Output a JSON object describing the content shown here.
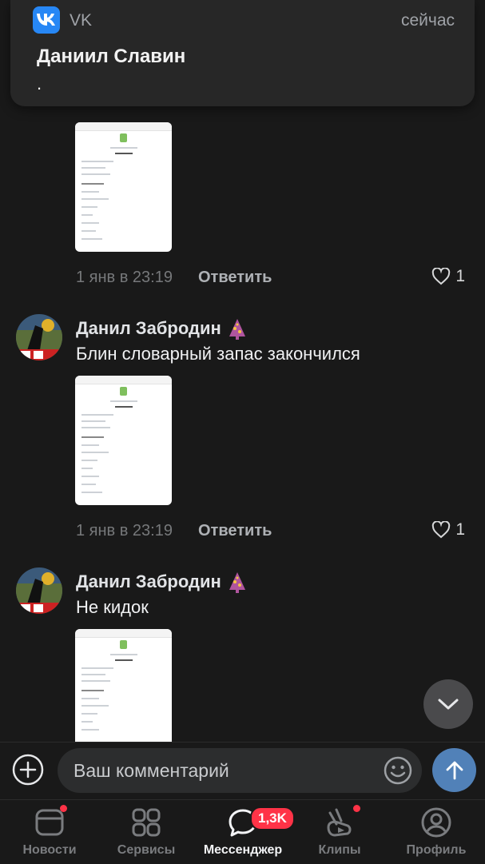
{
  "notification": {
    "app_name": "VK",
    "time": "сейчас",
    "sender": "Даниил Славин",
    "message": "."
  },
  "comments": [
    {
      "author": "",
      "text": "",
      "date": "1 янв в 23:19",
      "reply_label": "Ответить",
      "likes": "1"
    },
    {
      "author": "Данил Забродин",
      "text": "Блин словарный запас закончился",
      "date": "1 янв в 23:19",
      "reply_label": "Ответить",
      "likes": "1"
    },
    {
      "author": "Данил Забродин",
      "text": "Не кидок"
    }
  ],
  "composer": {
    "placeholder": "Ваш комментарий"
  },
  "tabs": [
    {
      "label": "Новости",
      "icon": "news-icon"
    },
    {
      "label": "Сервисы",
      "icon": "services-icon"
    },
    {
      "label": "Мессенджер",
      "icon": "messenger-icon",
      "badge": "1,3K"
    },
    {
      "label": "Клипы",
      "icon": "clips-icon"
    },
    {
      "label": "Профиль",
      "icon": "profile-icon"
    }
  ],
  "colors": {
    "background": "#191919",
    "accent": "#5181b8",
    "badge": "#ff3347",
    "vk_blue": "#2787f5"
  }
}
